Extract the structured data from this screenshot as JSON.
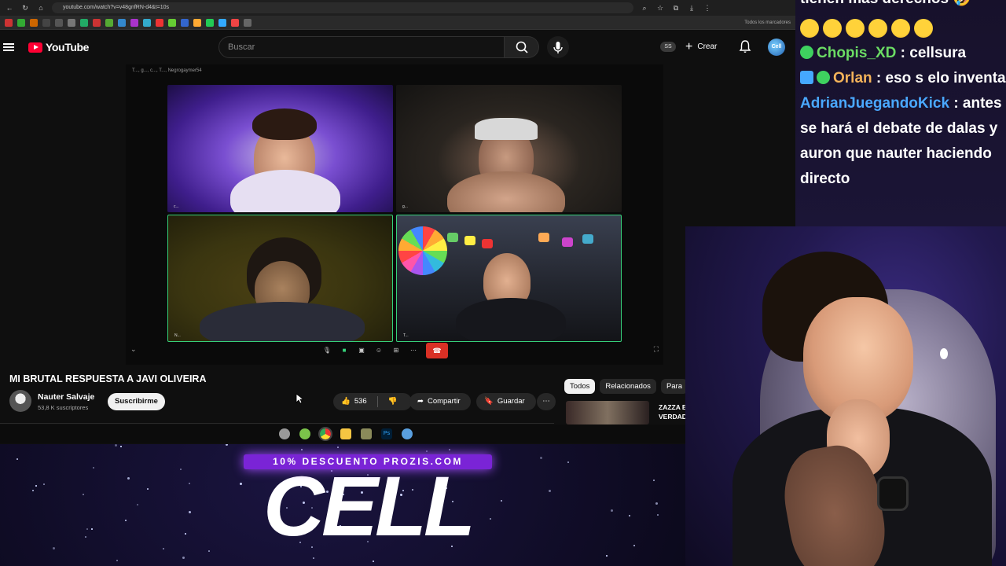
{
  "browser": {
    "url": "youtube.com/watch?v=v48gnfRN-d4&t=10s",
    "bookmarks_all": "Todos los marcadores"
  },
  "youtube": {
    "logo_text": "YouTube",
    "search_placeholder": "Buscar",
    "user_badge": "SS",
    "create_label": "Crear",
    "avatar_text": "Cell"
  },
  "video": {
    "participants_label": "T..., g..., c..., T..., Negrogaymer54",
    "tile_labels": [
      "c...",
      "g...",
      "N...",
      "T..."
    ],
    "title": "MI BRUTAL RESPUESTA A JAVI OLIVEIRA",
    "channel_name": "Nauter Salvaje",
    "subscribers": "53,8 K suscriptores",
    "subscribe_label": "Suscribirme",
    "likes": "536",
    "share_label": "Compartir",
    "save_label": "Guardar"
  },
  "sidebar": {
    "chips": [
      "Todos",
      "Relacionados",
      "Para"
    ],
    "rec_title": "ZAZZA E VERDAD"
  },
  "promo": {
    "banner": "10% DESCUENTO PROZIS.COM",
    "big_text": "CELL"
  },
  "chat": {
    "line_top": "tienen más derechos 🤣",
    "messages": [
      {
        "user": "Chopis_XD",
        "text": ": cellsura"
      },
      {
        "user": "Orlan",
        "text": ": eso s elo inventa"
      },
      {
        "user": "AdrianJuegandoKick",
        "text": ": antes se hará el debate de dalas y auron que nauter haciendo directo"
      }
    ]
  },
  "colors": {
    "yt_red": "#ff0033",
    "promo_purple": "#7a24d6",
    "meet_green": "#36d17a",
    "hangup_red": "#d93025"
  }
}
